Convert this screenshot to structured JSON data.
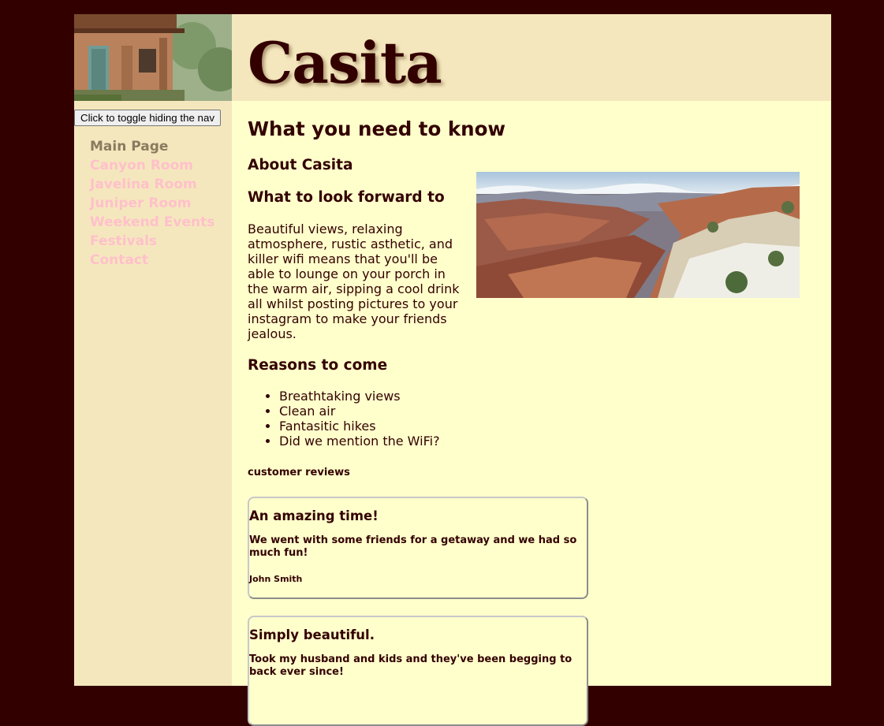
{
  "header": {
    "title": "Casita"
  },
  "sidebar": {
    "toggle_label": "Click to toggle hiding the nav",
    "nav": [
      {
        "label": "Main Page"
      },
      {
        "label": "Canyon Room"
      },
      {
        "label": "Javelina Room"
      },
      {
        "label": "Juniper Room"
      },
      {
        "label": "Weekend Events"
      },
      {
        "label": "Festivals"
      },
      {
        "label": "Contact"
      }
    ]
  },
  "main": {
    "heading": "What you need to know",
    "about_heading": "About Casita",
    "forward_heading": "What to look forward to",
    "forward_text": "Beautiful views, relaxing atmosphere, rustic asthetic, and killer wifi means that you'll be able to lounge on your porch in the warm air, sipping a cool drink all whilst posting pictures to your instagram to make your friends jealous.",
    "reasons_heading": "Reasons to come",
    "reasons": [
      "Breathtaking views",
      "Clean air",
      "Fantasitic hikes",
      "Did we mention the WiFi?"
    ],
    "reviews_label": "customer reviews",
    "reviews": [
      {
        "title": "An amazing time!",
        "text": "We went with some friends for a getaway and we had so much fun!",
        "author": "John Smith"
      },
      {
        "title": "Simply beautiful.",
        "text": "Took my husband and kids and they've been begging to back ever since!",
        "author": ""
      }
    ]
  },
  "colors": {
    "page_background": "#330000",
    "content_background": "#ffffcc",
    "header_background": "#f5e7bd",
    "text": "#330000",
    "nav_link": "#ffc0cb",
    "nav_active": "#8a7b60"
  }
}
